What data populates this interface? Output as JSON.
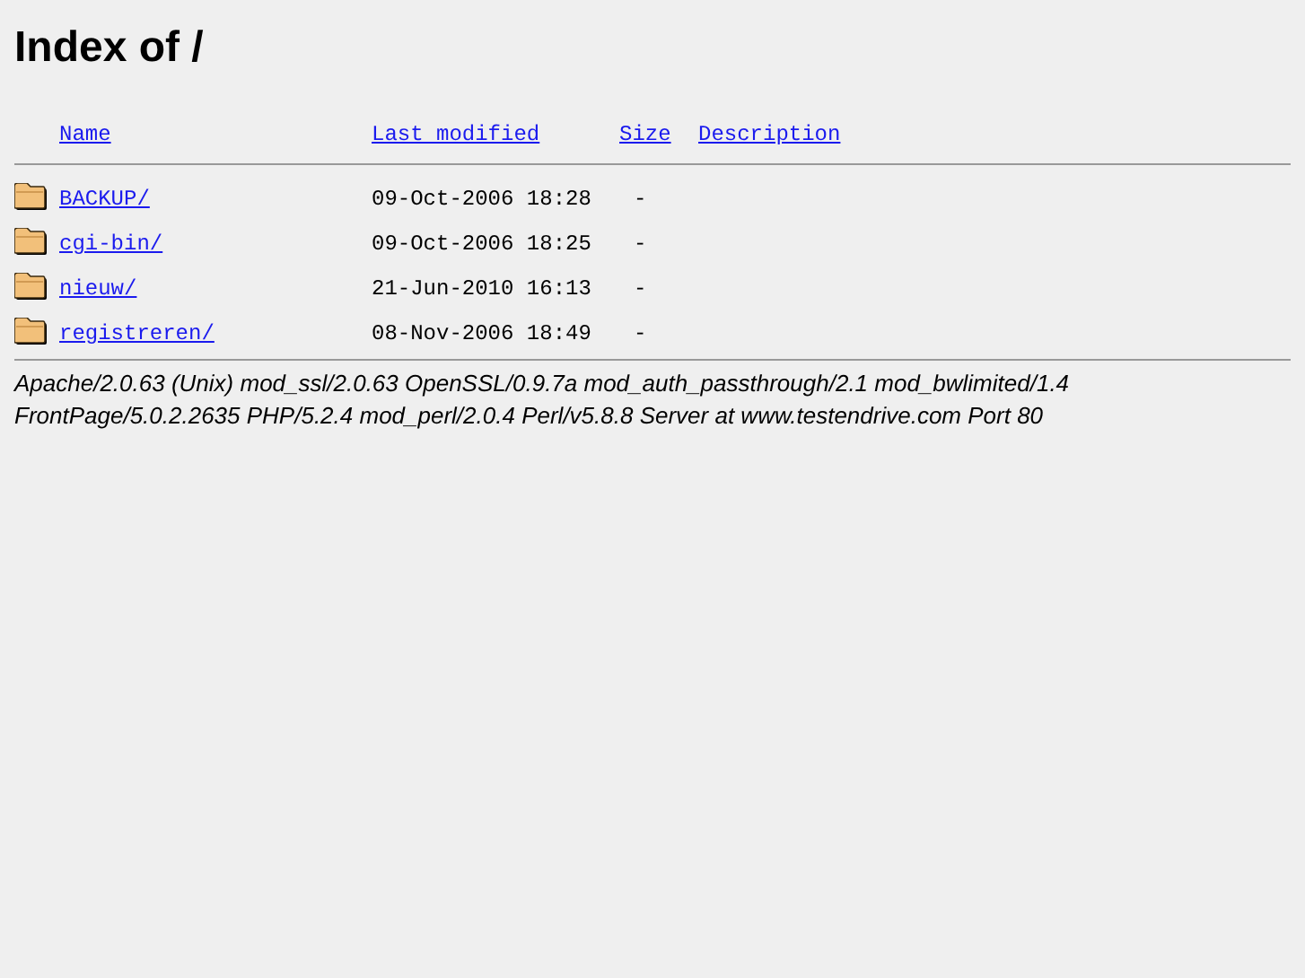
{
  "title": "Index of /",
  "columns": [
    "Name",
    "Last modified",
    "Size",
    "Description"
  ],
  "rows": [
    {
      "name": "BACKUP/",
      "modified": "09-Oct-2006 18:28",
      "size": "-"
    },
    {
      "name": "cgi-bin/",
      "modified": "09-Oct-2006 18:25",
      "size": "-"
    },
    {
      "name": "nieuw/",
      "modified": "21-Jun-2010 16:13",
      "size": "-"
    },
    {
      "name": "registreren/",
      "modified": "08-Nov-2006 18:49",
      "size": "-"
    }
  ],
  "footer": "Apache/2.0.63 (Unix) mod_ssl/2.0.63 OpenSSL/0.9.7a mod_auth_passthrough/2.1 mod_bwlimited/1.4 FrontPage/5.0.2.2635 PHP/5.2.4 mod_perl/2.0.4 Perl/v5.8.8 Server at www.testendrive.com Port 80"
}
